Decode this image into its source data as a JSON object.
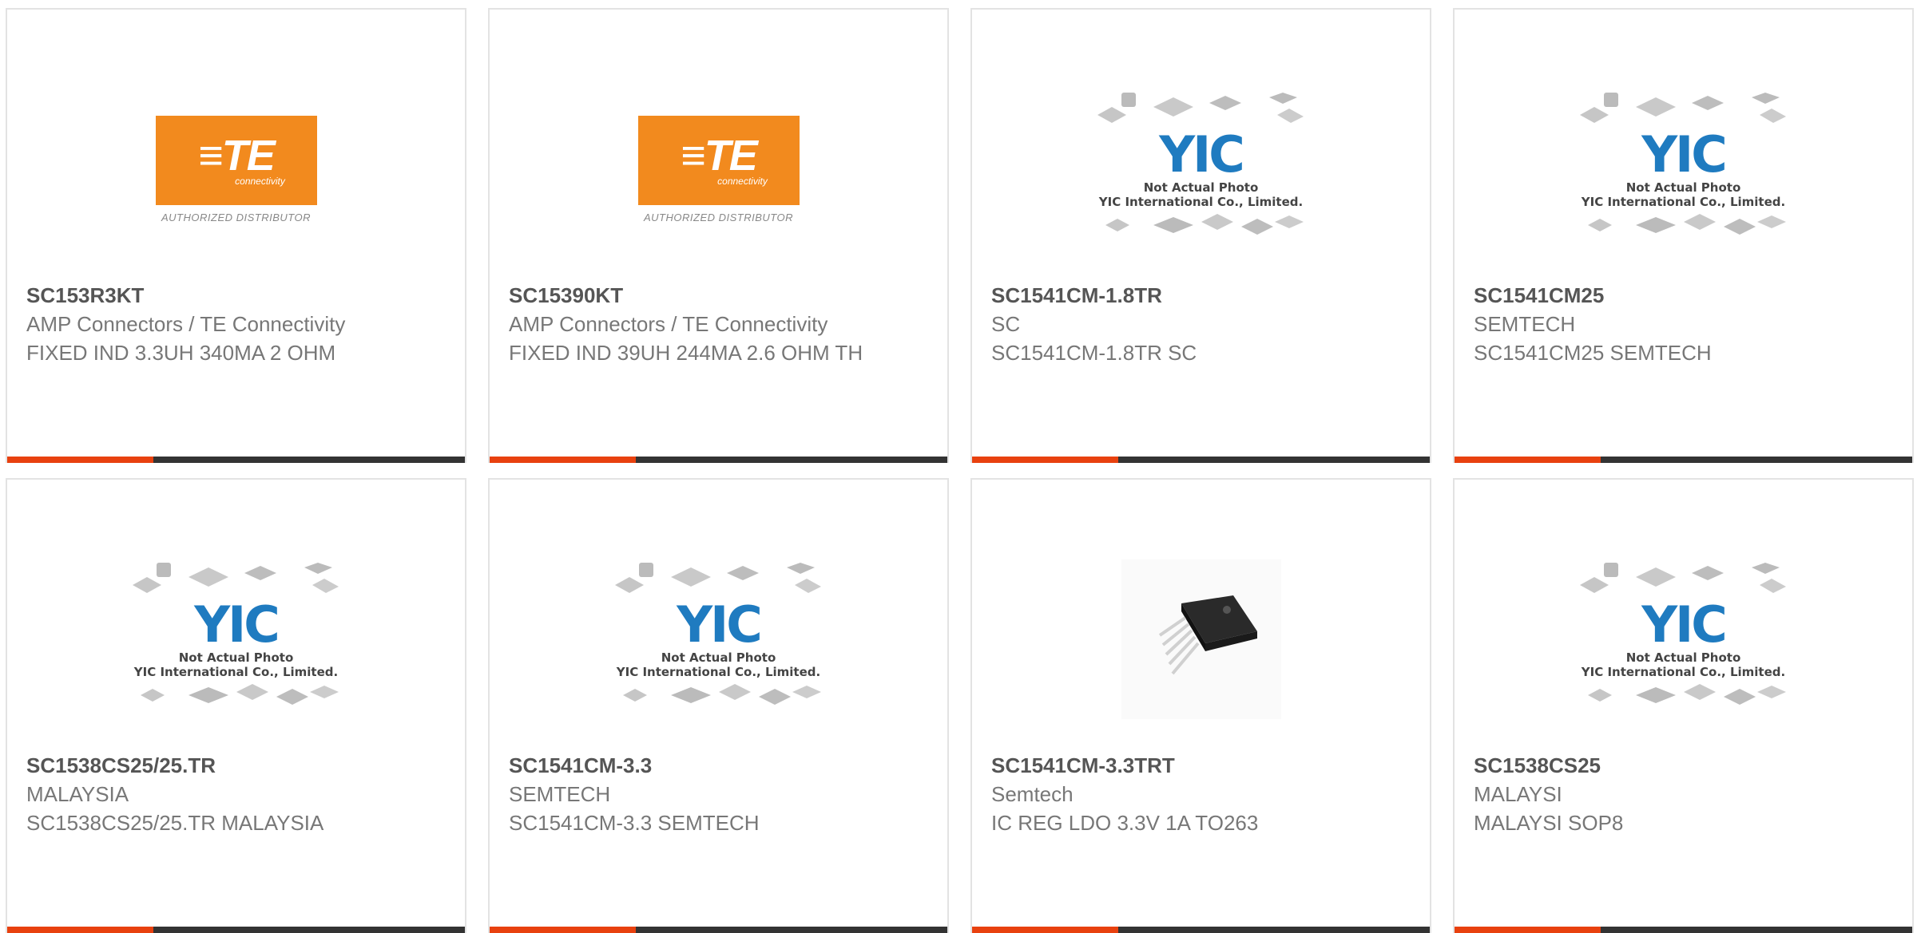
{
  "colors": {
    "accent": "#e8410f",
    "te_orange": "#f28a1e",
    "bar_dark": "#333333"
  },
  "te_logo": {
    "word": "≡TE",
    "sub": "connectivity",
    "distributor": "AUTHORIZED DISTRIBUTOR"
  },
  "yic_placeholder": {
    "brand": "YIC",
    "line1": "Not Actual Photo",
    "line2": "YIC International Co., Limited."
  },
  "products": [
    {
      "part_number": "SC153R3KT",
      "manufacturer": "AMP Connectors / TE Connectivity",
      "description": "FIXED IND 3.3UH 340MA 2 OHM",
      "image": "te-logo"
    },
    {
      "part_number": "SC15390KT",
      "manufacturer": "AMP Connectors / TE Connectivity",
      "description": "FIXED IND 39UH 244MA 2.6 OHM TH",
      "image": "te-logo"
    },
    {
      "part_number": "SC1541CM-1.8TR",
      "manufacturer": "SC",
      "description": "SC1541CM-1.8TR SC",
      "image": "yic-placeholder"
    },
    {
      "part_number": "SC1541CM25",
      "manufacturer": "SEMTECH",
      "description": "SC1541CM25 SEMTECH",
      "image": "yic-placeholder"
    },
    {
      "part_number": "SC1538CS25/25.TR",
      "manufacturer": "MALAYSIA",
      "description": "SC1538CS25/25.TR MALAYSIA",
      "image": "yic-placeholder"
    },
    {
      "part_number": "SC1541CM-3.3",
      "manufacturer": "SEMTECH",
      "description": "SC1541CM-3.3 SEMTECH",
      "image": "yic-placeholder"
    },
    {
      "part_number": "SC1541CM-3.3TRT",
      "manufacturer": "Semtech",
      "description": "IC REG LDO 3.3V 1A TO263",
      "image": "product-photo"
    },
    {
      "part_number": "SC1538CS25",
      "manufacturer": "MALAYSI",
      "description": "MALAYSI SOP8",
      "image": "yic-placeholder"
    }
  ]
}
